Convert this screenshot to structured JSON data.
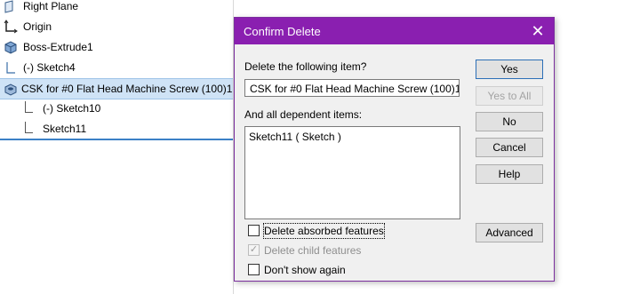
{
  "tree": {
    "items": [
      {
        "label": "Right Plane",
        "icon": "plane-icon"
      },
      {
        "label": "Origin",
        "icon": "origin-icon"
      },
      {
        "label": "Boss-Extrude1",
        "icon": "extrude-icon"
      },
      {
        "label": "(-) Sketch4",
        "icon": "sketch-icon"
      },
      {
        "label": "CSK for #0 Flat Head Machine Screw (100)1",
        "icon": "hole-wizard-icon"
      },
      {
        "label": "(-) Sketch10",
        "icon": "sketch-icon"
      },
      {
        "label": "Sketch11",
        "icon": "sketch-icon"
      }
    ],
    "selected_color": "#cfe3f6"
  },
  "dialog": {
    "title": "Confirm Delete",
    "close_glyph": "✕",
    "delete_prompt": "Delete the following item?",
    "item_value": "CSK for #0 Flat Head Machine Screw (100)1 (",
    "dependents_label": "And all dependent items:",
    "dependents": [
      "Sketch11 ( Sketch )"
    ],
    "buttons": {
      "yes": "Yes",
      "yes_to_all": "Yes to All",
      "no": "No",
      "cancel": "Cancel",
      "help": "Help",
      "advanced": "Advanced"
    },
    "checkboxes": {
      "delete_absorbed": {
        "label": "Delete absorbed features",
        "checked": false,
        "enabled": true
      },
      "delete_child": {
        "label": "Delete child features",
        "checked": true,
        "enabled": false
      },
      "dont_show": {
        "label": "Don't show again",
        "checked": false,
        "enabled": true
      }
    },
    "titlebar_color": "#8a1fb0"
  }
}
